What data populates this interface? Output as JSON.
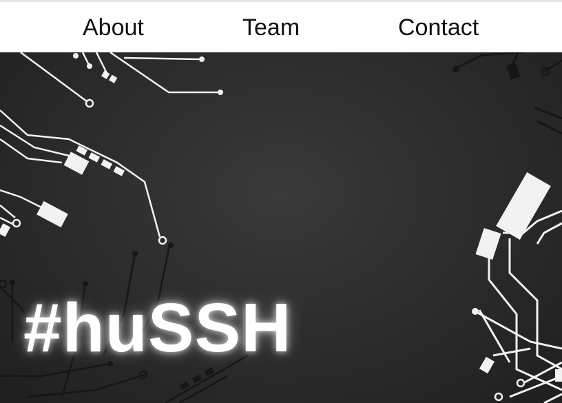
{
  "nav": {
    "items": [
      {
        "label": "About"
      },
      {
        "label": "Team"
      },
      {
        "label": "Contact"
      }
    ]
  },
  "hero": {
    "title": "#huSSH",
    "background_image": "circuit-board-traces"
  },
  "colors": {
    "navbar_bg": "#ffffff",
    "nav_text": "#111111",
    "hero_bg": "#2a2a2a",
    "trace_light": "#f2f2f2",
    "trace_dark": "#161616",
    "title": "#ffffff"
  }
}
